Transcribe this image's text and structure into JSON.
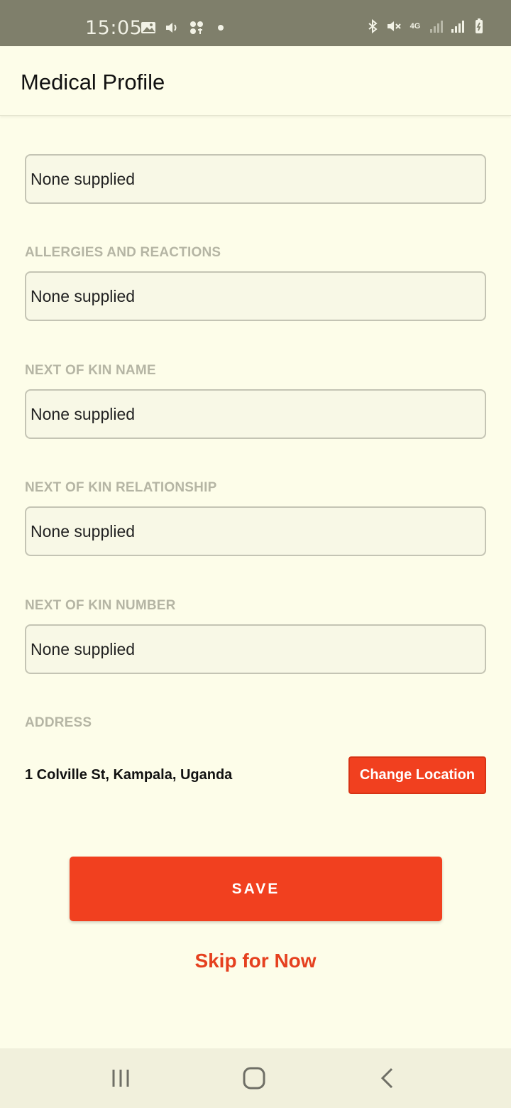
{
  "status_bar": {
    "time": "15:05",
    "network": "4G",
    "icons_left": [
      "image-icon",
      "volume-icon",
      "app-notification-icon",
      "dot-icon"
    ],
    "icons_right": [
      "bluetooth-icon",
      "mute-icon",
      "4g-icon",
      "signal-icon",
      "signal-icon",
      "battery-icon"
    ]
  },
  "app_bar": {
    "title": "Medical Profile"
  },
  "fields": [
    {
      "label": "",
      "value": "None supplied"
    },
    {
      "label": "ALLERGIES AND REACTIONS",
      "value": "None supplied"
    },
    {
      "label": "NEXT OF KIN NAME",
      "value": "None supplied"
    },
    {
      "label": "NEXT OF KIN RELATIONSHIP",
      "value": "None supplied"
    },
    {
      "label": "NEXT OF KIN NUMBER",
      "value": "None supplied"
    }
  ],
  "address": {
    "label": "ADDRESS",
    "value": "1 Colville St, Kampala, Uganda",
    "change_label": "Change Location"
  },
  "actions": {
    "save_label": "SAVE",
    "skip_label": "Skip for Now"
  },
  "colors": {
    "accent": "#f1401f",
    "background": "#fdfde9",
    "status_bar": "#7f7f6b"
  }
}
